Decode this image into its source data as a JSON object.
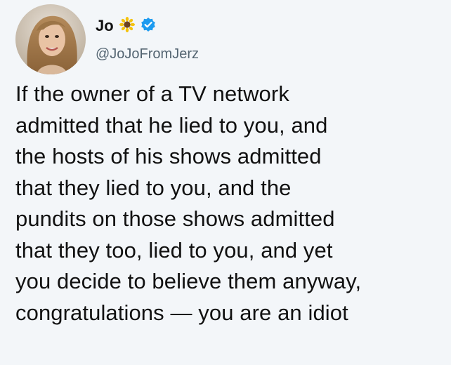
{
  "tweet": {
    "author": {
      "display_name": "Jo",
      "handle": "@JoJoFromJerz",
      "emoji": "sunflower-icon",
      "verified": true,
      "verified_color": "#1d9bf0"
    },
    "lines": [
      "If the owner of a TV network",
      "admitted that he lied to you, and",
      "the hosts of his shows admitted",
      "that they lied to you, and the",
      "pundits on those shows admitted",
      "that they too, lied to you, and yet",
      "you decide to believe them anyway,",
      "congratulations — you are an idiot"
    ]
  }
}
